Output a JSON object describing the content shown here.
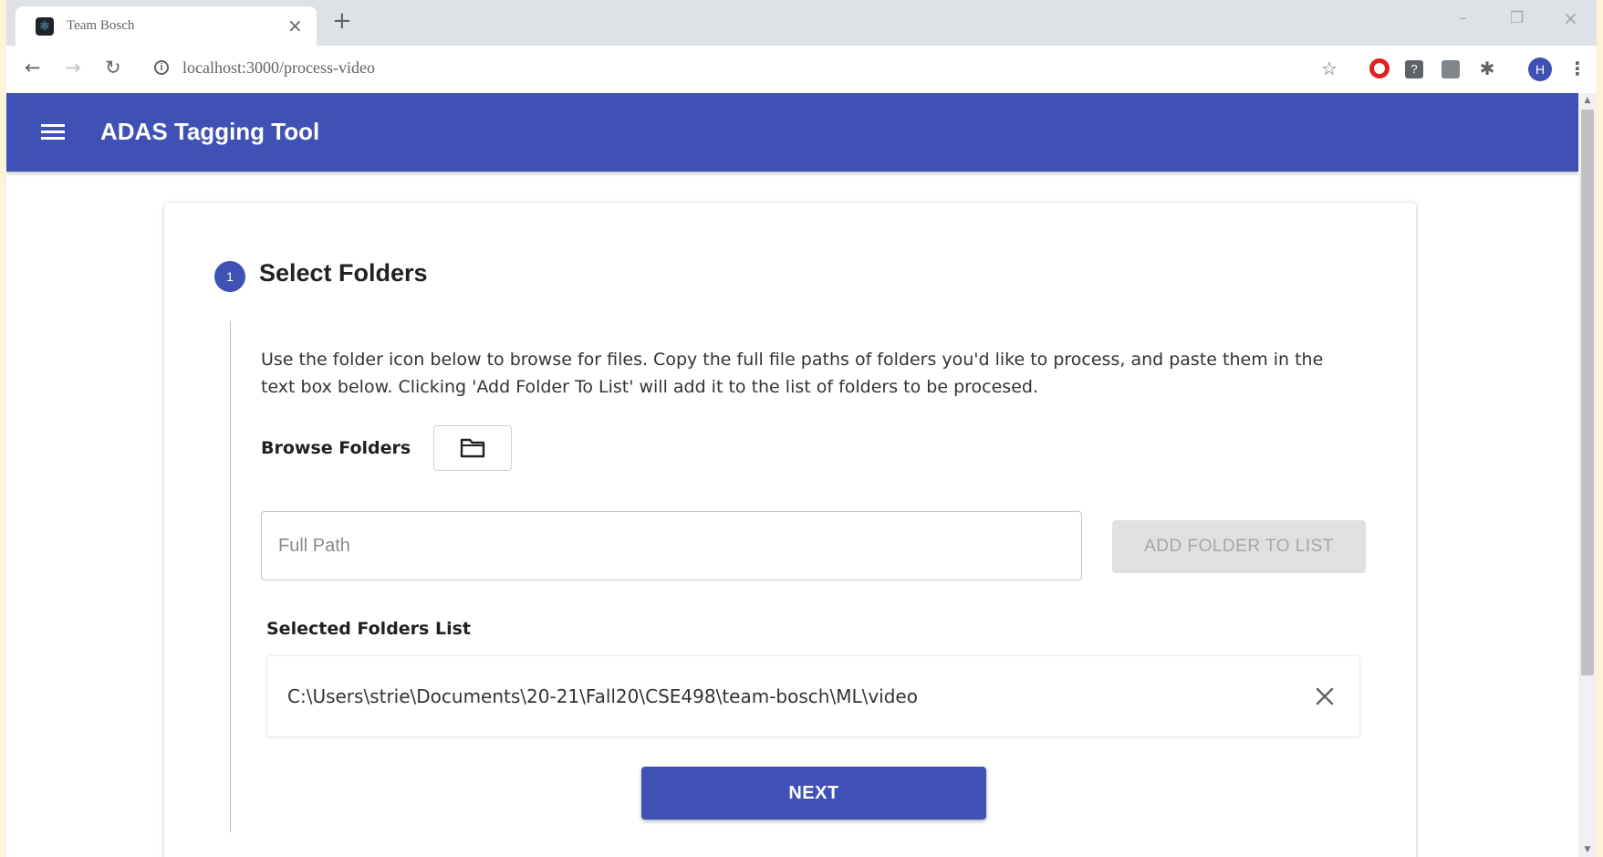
{
  "browser": {
    "tab_title": "Team Bosch",
    "tab_close": "×",
    "new_tab": "+",
    "url": "localhost:3000/process-video",
    "profile_initial": "H",
    "window_controls": {
      "minimize": "–",
      "restore": "❐",
      "close": "×"
    }
  },
  "appbar": {
    "title": "ADAS Tagging Tool",
    "color": "#3f51b5"
  },
  "step": {
    "number": "1",
    "title": "Select Folders",
    "instructions": "Use the folder icon below to browse for files. Copy the full file paths of folders you'd like to process, and paste them in the text box below. Clicking 'Add Folder To List' will add it to the list of folders to be procesed.",
    "browse_label": "Browse Folders",
    "path_placeholder": "Full Path",
    "add_button": "ADD FOLDER TO LIST",
    "list_label": "Selected Folders List",
    "folders": [
      "C:\\Users\\strie\\Documents\\20-21\\Fall20\\CSE498\\team-bosch\\ML\\video"
    ],
    "next_button": "NEXT"
  },
  "icons": {
    "menu": "hamburger-menu-icon",
    "folder": "folder-icon",
    "remove": "close-icon"
  }
}
